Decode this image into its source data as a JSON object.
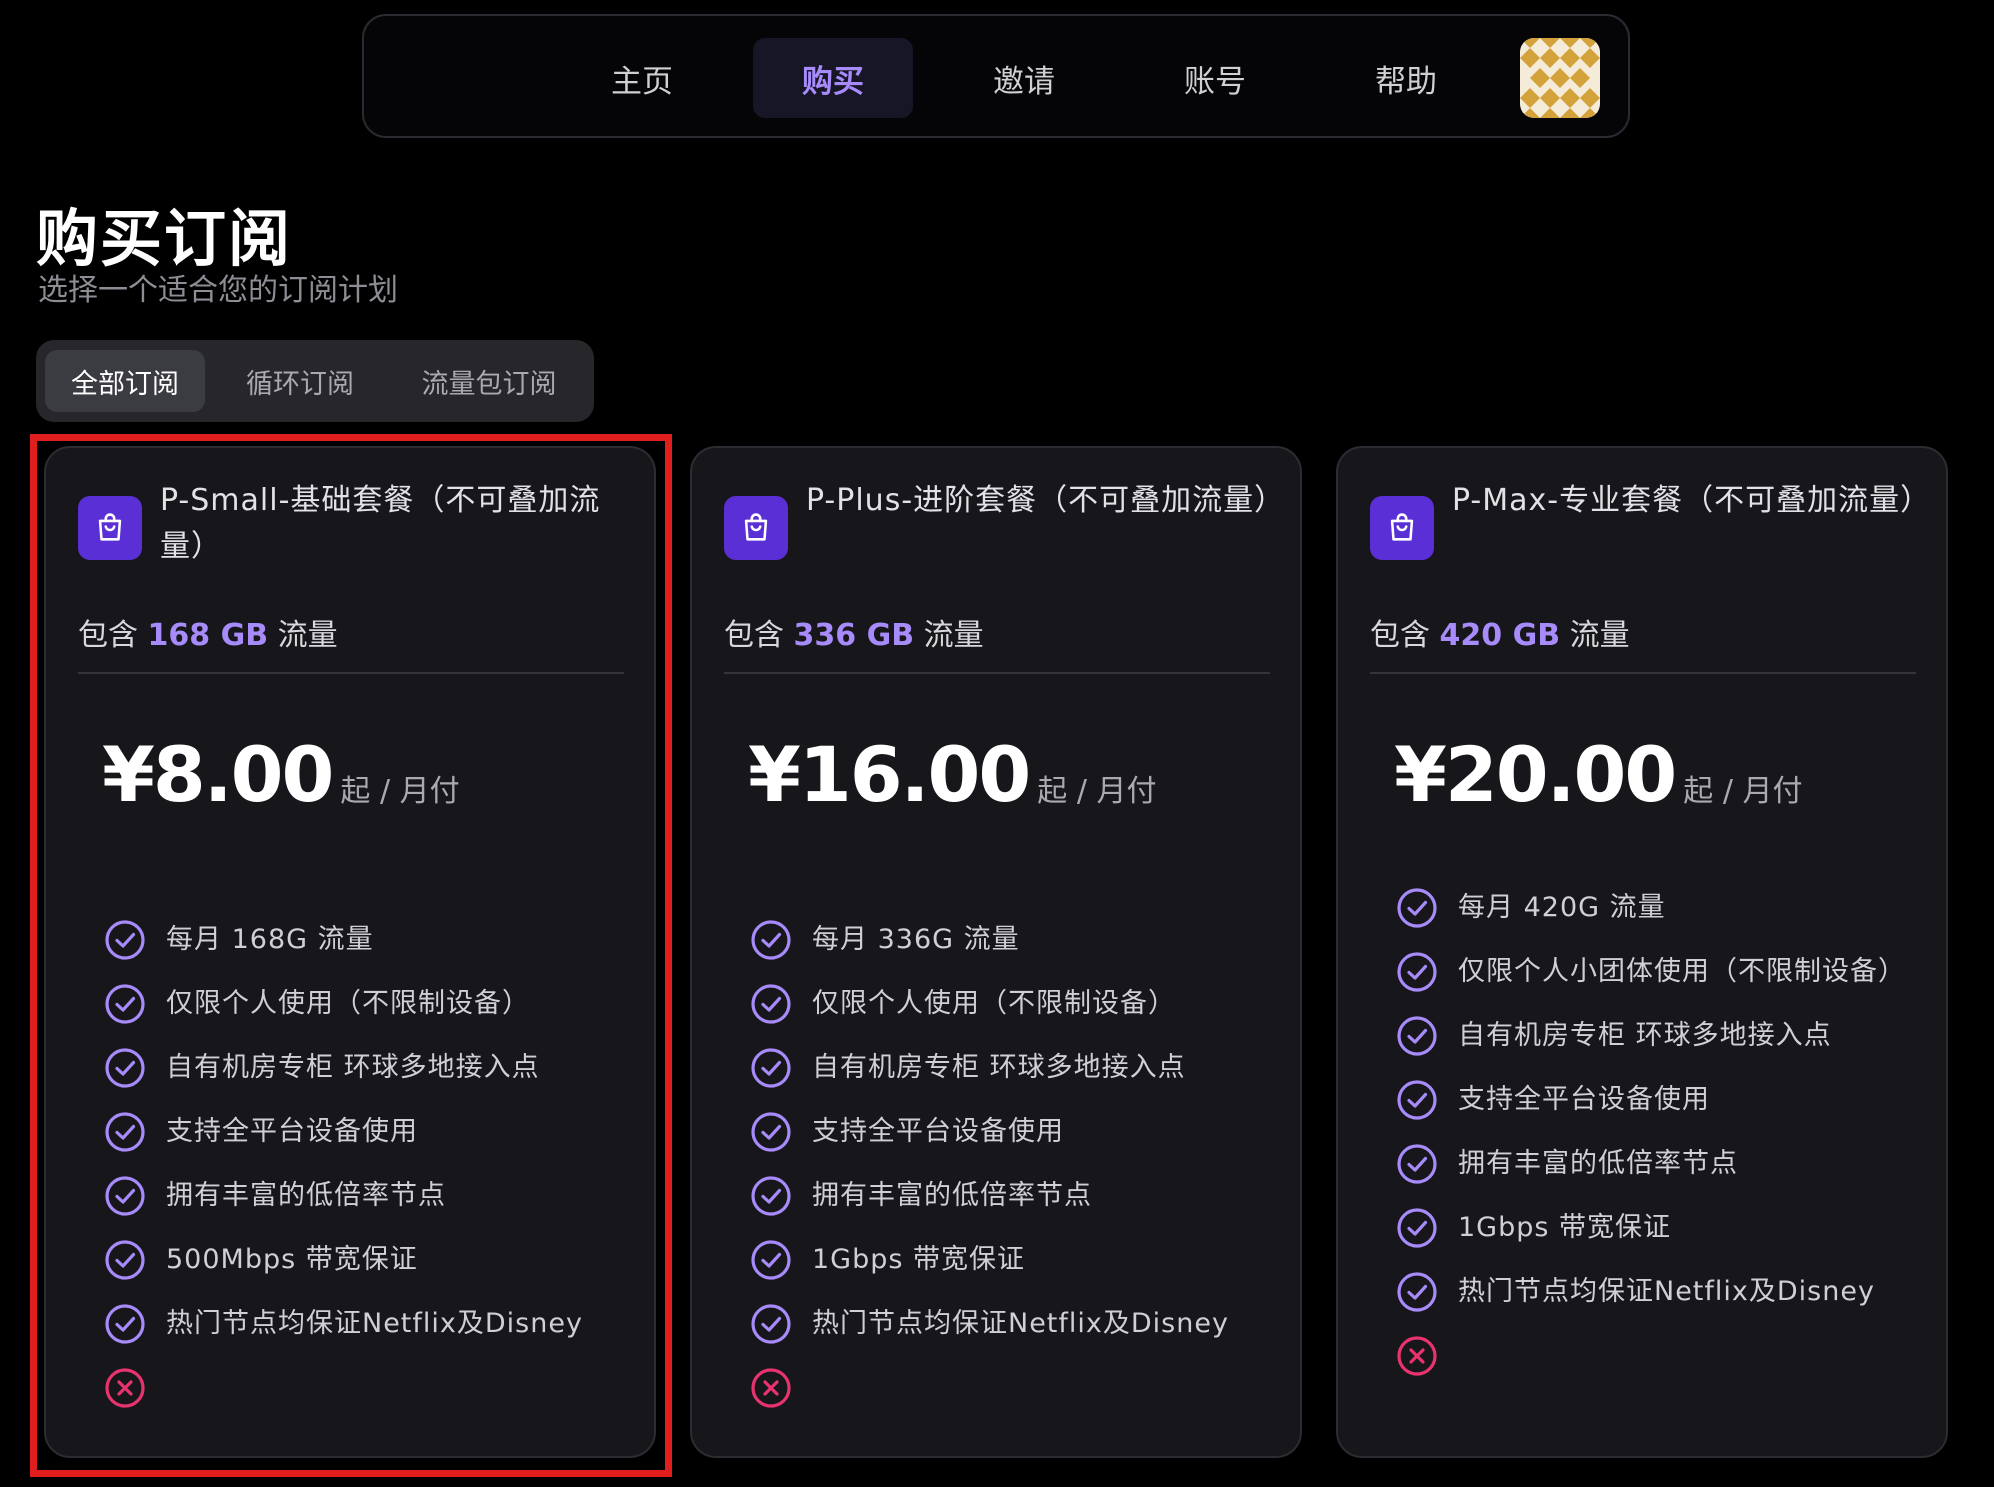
{
  "nav": {
    "items": [
      {
        "label": "主页",
        "active": false
      },
      {
        "label": "购买",
        "active": true
      },
      {
        "label": "邀请",
        "active": false
      },
      {
        "label": "账号",
        "active": false
      },
      {
        "label": "帮助",
        "active": false
      }
    ],
    "avatar_icon": "pattern-avatar"
  },
  "header": {
    "title": "购买订阅",
    "subtitle": "选择一个适合您的订阅计划"
  },
  "filter_tabs": [
    {
      "label": "全部订阅",
      "active": true
    },
    {
      "label": "循环订阅",
      "active": false
    },
    {
      "label": "流量包订阅",
      "active": false
    }
  ],
  "plans": [
    {
      "name": "P-Small-基础套餐（不可叠加流量）",
      "traffic_prefix": "包含",
      "traffic_amount": "168 GB",
      "traffic_suffix": "流量",
      "price": "¥8.00",
      "price_suffix": "起 / 月付",
      "features": [
        "每月 168G 流量",
        "仅限个人使用（不限制设备）",
        "自有机房专柜 环球多地接入点",
        "支持全平台设备使用",
        "拥有丰富的低倍率节点",
        "500Mbps 带宽保证",
        "热门节点均保证Netflix及Disney"
      ],
      "highlighted": true
    },
    {
      "name": "P-Plus-进阶套餐（不可叠加流量）",
      "traffic_prefix": "包含",
      "traffic_amount": "336 GB",
      "traffic_suffix": "流量",
      "price": "¥16.00",
      "price_suffix": "起 / 月付",
      "features": [
        "每月 336G 流量",
        "仅限个人使用（不限制设备）",
        "自有机房专柜 环球多地接入点",
        "支持全平台设备使用",
        "拥有丰富的低倍率节点",
        "1Gbps 带宽保证",
        "热门节点均保证Netflix及Disney"
      ],
      "highlighted": false
    },
    {
      "name": "P-Max-专业套餐（不可叠加流量）",
      "traffic_prefix": "包含",
      "traffic_amount": "420 GB",
      "traffic_suffix": "流量",
      "price": "¥20.00",
      "price_suffix": "起 / 月付",
      "features": [
        "每月 420G 流量",
        "仅限个人小团体使用（不限制设备）",
        "自有机房专柜 环球多地接入点",
        "支持全平台设备使用",
        "拥有丰富的低倍率节点",
        "1Gbps 带宽保证",
        "热门节点均保证Netflix及Disney"
      ],
      "highlighted": false
    }
  ],
  "icons": {
    "plan": "shopping-bag-icon",
    "included": "check-circle-icon",
    "excluded": "x-circle-icon"
  },
  "colors": {
    "background": "#000000",
    "card": "#17171b",
    "accent": "#a78bfa",
    "icon_bg": "#5b2fd6",
    "check": "#a78bfa",
    "cross": "#e8336e",
    "highlight_border": "#e01e1e"
  }
}
